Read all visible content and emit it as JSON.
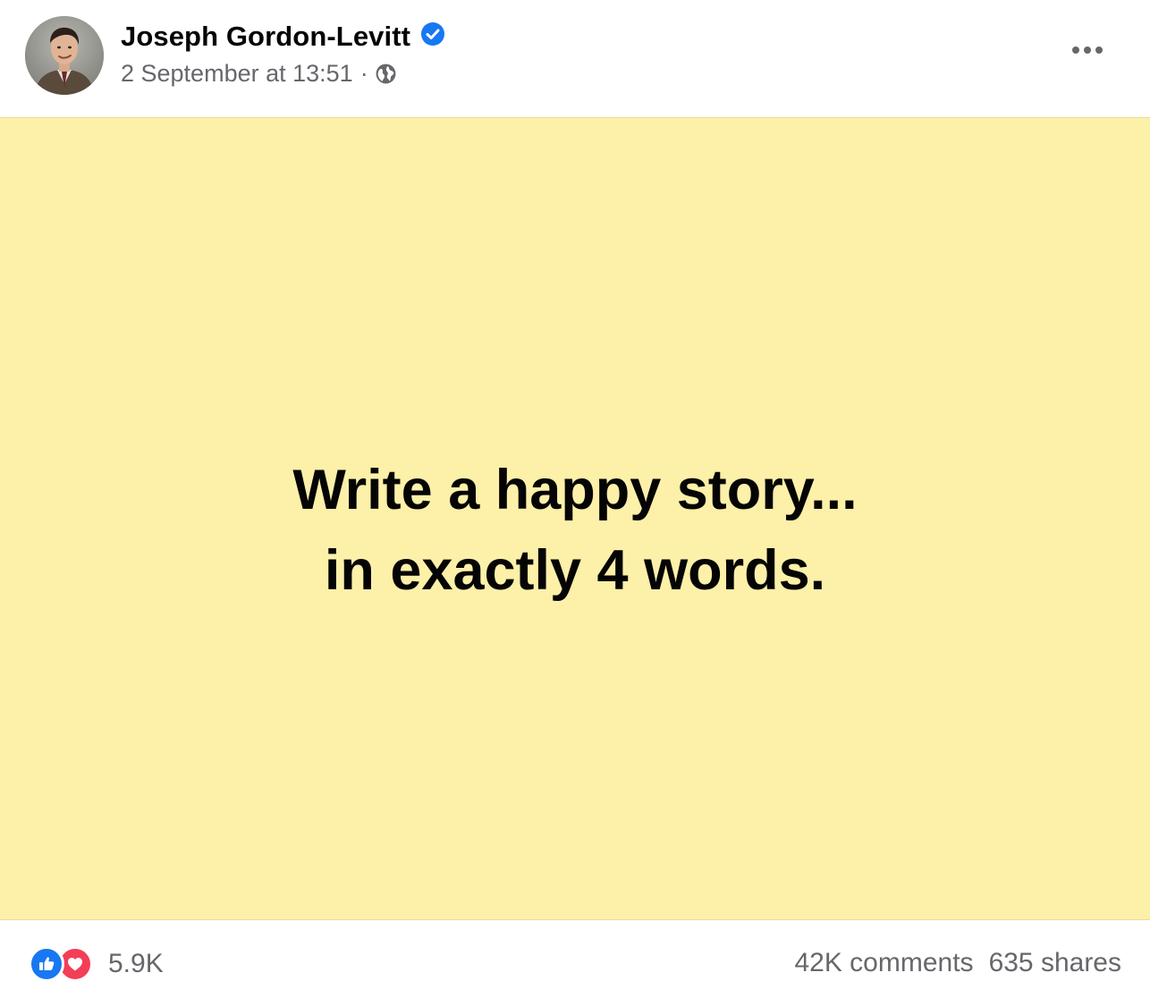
{
  "post": {
    "author": "Joseph Gordon-Levitt",
    "timestamp": "2 September at 13:51",
    "separator": "·",
    "privacy_icon": "globe-icon",
    "verified_icon": "verified-badge-icon",
    "more_icon": "more-options-icon",
    "text_lines": [
      "Write a happy story...",
      "in exactly 4 words."
    ],
    "background_color": "#fdf0a9"
  },
  "engagement": {
    "reactions": [
      "like",
      "love"
    ],
    "reaction_count": "5.9K",
    "comments": "42K comments",
    "shares": "635 shares"
  },
  "colors": {
    "accent": "#1877f2",
    "love": "#f33e58",
    "secondary_text": "#65676b"
  }
}
